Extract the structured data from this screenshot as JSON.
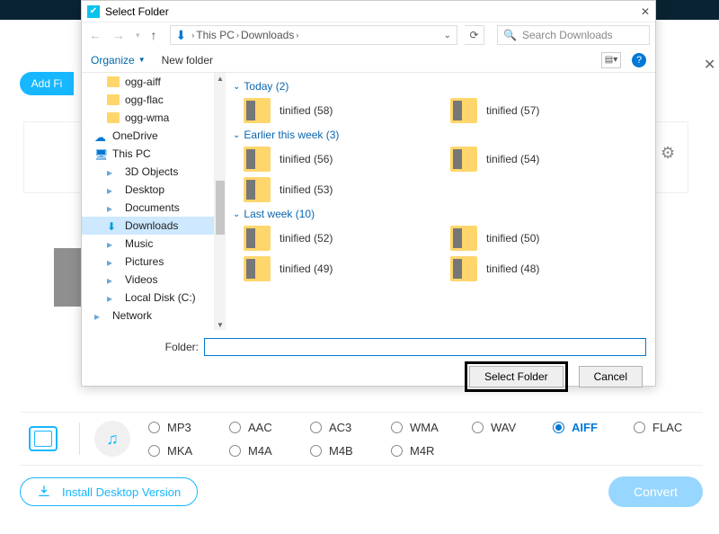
{
  "background": {
    "add_label": "Add Fi",
    "close_x": "✕",
    "music_note": "♪",
    "gear": "⚙",
    "install_label": "Install Desktop Version",
    "convert_label": "Convert"
  },
  "formats": {
    "row1": [
      "MP3",
      "AAC",
      "AC3",
      "WMA",
      "WAV",
      "AIFF",
      "FLAC"
    ],
    "row2": [
      "MKA",
      "M4A",
      "M4B",
      "M4R"
    ],
    "selected": "AIFF"
  },
  "dialog": {
    "title": "Select Folder",
    "nav_back": "←",
    "nav_fwd": "→",
    "nav_up": "↑",
    "crumbs": [
      "This PC",
      "Downloads"
    ],
    "search_placeholder": "Search Downloads",
    "organize": "Organize",
    "new_folder": "New folder",
    "tree": [
      {
        "label": "ogg-aiff",
        "icon": "folder",
        "lv": 2
      },
      {
        "label": "ogg-flac",
        "icon": "folder",
        "lv": 2
      },
      {
        "label": "ogg-wma",
        "icon": "folder",
        "lv": 2
      },
      {
        "label": "OneDrive",
        "icon": "cloud",
        "lv": 1
      },
      {
        "label": "This PC",
        "icon": "pc",
        "lv": 1
      },
      {
        "label": "3D Objects",
        "icon": "generic",
        "lv": 2
      },
      {
        "label": "Desktop",
        "icon": "generic",
        "lv": 2
      },
      {
        "label": "Documents",
        "icon": "generic",
        "lv": 2
      },
      {
        "label": "Downloads",
        "icon": "dl",
        "lv": 2,
        "sel": true
      },
      {
        "label": "Music",
        "icon": "generic",
        "lv": 2
      },
      {
        "label": "Pictures",
        "icon": "generic",
        "lv": 2
      },
      {
        "label": "Videos",
        "icon": "generic",
        "lv": 2
      },
      {
        "label": "Local Disk (C:)",
        "icon": "generic",
        "lv": 2
      },
      {
        "label": "Network",
        "icon": "generic",
        "lv": 1
      }
    ],
    "groups": [
      {
        "header": "Today (2)",
        "items": [
          "tinified (58)",
          "tinified (57)"
        ]
      },
      {
        "header": "Earlier this week (3)",
        "items": [
          "tinified (56)",
          "tinified (54)",
          "tinified (53)"
        ]
      },
      {
        "header": "Last week (10)",
        "items": [
          "tinified (52)",
          "tinified (50)",
          "tinified (49)",
          "tinified (48)"
        ]
      }
    ],
    "folder_label": "Folder:",
    "folder_value": "",
    "select_btn": "Select Folder",
    "cancel_btn": "Cancel"
  }
}
